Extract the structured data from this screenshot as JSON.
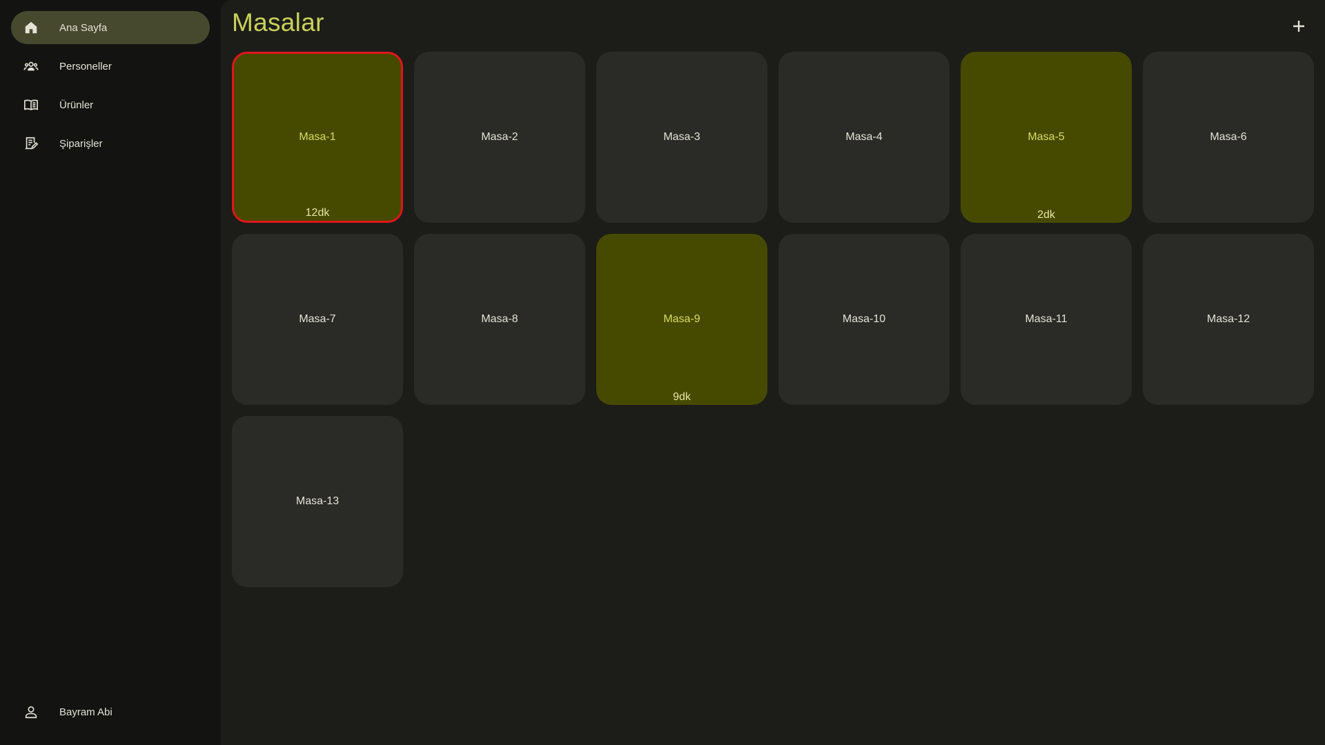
{
  "sidebar": {
    "items": [
      {
        "label": "Ana Sayfa",
        "icon": "home-icon",
        "active": true
      },
      {
        "label": "Personeller",
        "icon": "people-icon",
        "active": false
      },
      {
        "label": "Ürünler",
        "icon": "book-icon",
        "active": false
      },
      {
        "label": "Şiparişler",
        "icon": "receipt-icon",
        "active": false
      }
    ],
    "user": {
      "label": "Bayram Abi",
      "icon": "person-icon"
    }
  },
  "main": {
    "title": "Masalar",
    "add_icon": "plus-icon",
    "tables": [
      {
        "name": "Masa-1",
        "occupied": true,
        "alert": true,
        "time": "12dk"
      },
      {
        "name": "Masa-2",
        "occupied": false,
        "alert": false,
        "time": ""
      },
      {
        "name": "Masa-3",
        "occupied": false,
        "alert": false,
        "time": ""
      },
      {
        "name": "Masa-4",
        "occupied": false,
        "alert": false,
        "time": ""
      },
      {
        "name": "Masa-5",
        "occupied": true,
        "alert": false,
        "time": "2dk"
      },
      {
        "name": "Masa-6",
        "occupied": false,
        "alert": false,
        "time": ""
      },
      {
        "name": "Masa-7",
        "occupied": false,
        "alert": false,
        "time": ""
      },
      {
        "name": "Masa-8",
        "occupied": false,
        "alert": false,
        "time": ""
      },
      {
        "name": "Masa-9",
        "occupied": true,
        "alert": false,
        "time": "9dk"
      },
      {
        "name": "Masa-10",
        "occupied": false,
        "alert": false,
        "time": ""
      },
      {
        "name": "Masa-11",
        "occupied": false,
        "alert": false,
        "time": ""
      },
      {
        "name": "Masa-12",
        "occupied": false,
        "alert": false,
        "time": ""
      },
      {
        "name": "Masa-13",
        "occupied": false,
        "alert": false,
        "time": ""
      }
    ]
  },
  "colors": {
    "accent": "#c9d15a",
    "occupied": "#464a00",
    "alert_border": "#e3141b",
    "card": "#2a2b26",
    "active_nav": "#47492f"
  }
}
